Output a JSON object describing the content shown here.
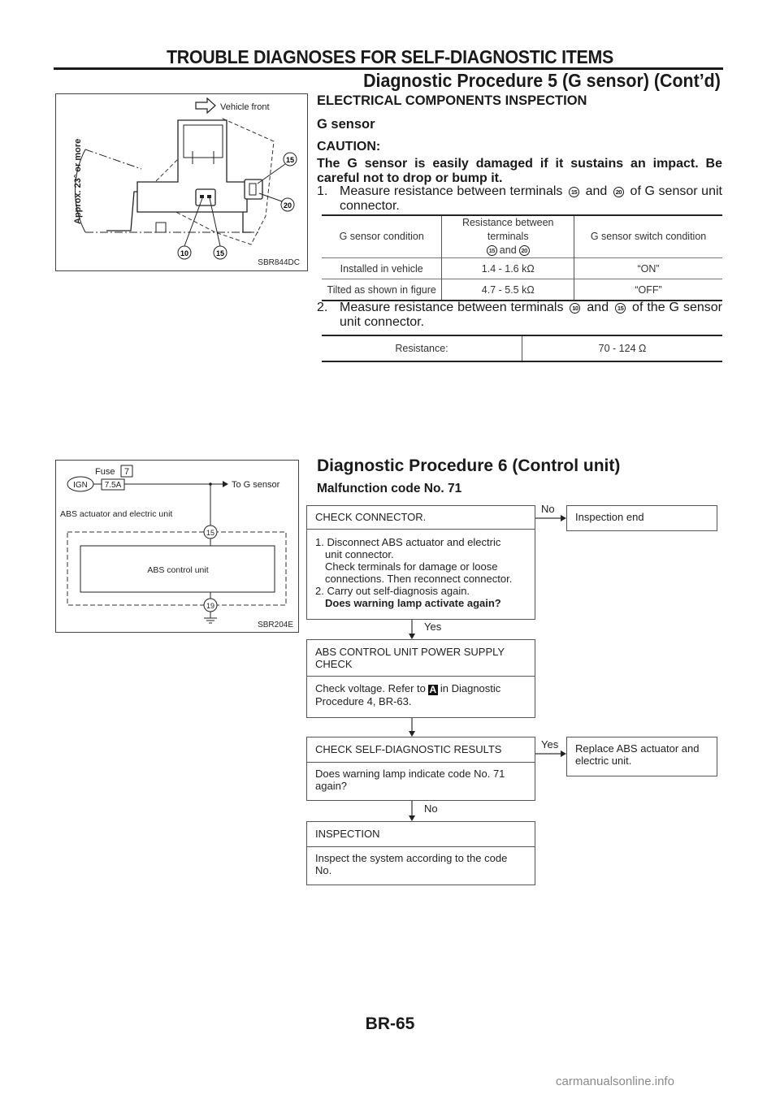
{
  "header": {
    "section_title": "TROUBLE DIAGNOSES FOR SELF-DIAGNOSTIC ITEMS",
    "subtitle": "Diagnostic Procedure 5 (G sensor) (Cont’d)"
  },
  "figure1": {
    "vehicle_front_label": "Vehicle front",
    "angle_label": "Approx. 23° or more",
    "terminals": [
      "15",
      "20",
      "10",
      "15"
    ],
    "figure_code": "SBR844DC"
  },
  "inspection": {
    "title": "ELECTRICAL COMPONENTS INSPECTION",
    "subtitle": "G sensor",
    "caution_heading": "CAUTION:",
    "caution_text": "The G sensor is easily damaged if it sustains an impact. Be careful not to drop or bump it.",
    "step1": {
      "num": "1.",
      "text_a": "Measure resistance between terminals",
      "term_a": "15",
      "and": "and",
      "term_b": "20",
      "text_b": "of G sensor unit connector."
    },
    "table1": {
      "headers": [
        "G sensor condition",
        "Resistance between terminals",
        "G sensor switch condition"
      ],
      "header_terminals": [
        "15",
        "20"
      ],
      "header_and": "and",
      "rows": [
        [
          "Installed in vehicle",
          "1.4 - 1.6 kΩ",
          "“ON”"
        ],
        [
          "Tilted as shown in figure",
          "4.7 - 5.5 kΩ",
          "“OFF”"
        ]
      ]
    },
    "step2": {
      "num": "2.",
      "text_a": "Measure resistance between terminals",
      "term_a": "10",
      "and": "and",
      "term_b": "15",
      "text_b": "of the G sensor unit connector."
    },
    "table2": {
      "label": "Resistance:",
      "value": "70 - 124 Ω"
    }
  },
  "figure2": {
    "fuse_label": "Fuse",
    "fuse_number": "7",
    "ign_label": "IGN",
    "fuse_rating": "7.5A",
    "to_label": "To G sensor",
    "unit_label": "ABS actuator and electric unit",
    "control_unit_label": "ABS control unit",
    "terminal_top": "15",
    "terminal_bottom": "19",
    "figure_code": "SBR204E"
  },
  "procedure6": {
    "title": "Diagnostic Procedure 6 (Control unit)",
    "subtitle": "Malfunction code No. 71",
    "box1": {
      "heading": "CHECK CONNECTOR.",
      "line1": "1. Disconnect ABS actuator and electric",
      "line2": "unit connector.",
      "line3": "Check terminals for damage or loose",
      "line4": "connections. Then reconnect connector.",
      "line5": "2. Carry out self-diagnosis again.",
      "line6": "Does warning lamp activate again?"
    },
    "box1_no_label": "No",
    "box1_no_result": "Inspection end",
    "box1_yes_label": "Yes",
    "box2": {
      "heading": "ABS CONTROL UNIT POWER SUPPLY CHECK",
      "text_a": "Check voltage. Refer to",
      "ref": "A",
      "text_b": "in Diagnostic Procedure 4, BR-63."
    },
    "box3": {
      "heading": "CHECK SELF-DIAGNOSTIC RESULTS",
      "text": "Does warning lamp indicate code No. 71 again?"
    },
    "box3_yes_label": "Yes",
    "box3_yes_result": "Replace ABS actuator and electric unit.",
    "box3_no_label": "No",
    "box4": {
      "heading": "INSPECTION",
      "text": "Inspect the system according to the code No."
    }
  },
  "footer": {
    "page_number": "BR-65",
    "watermark": "carmanualsonline.info"
  }
}
